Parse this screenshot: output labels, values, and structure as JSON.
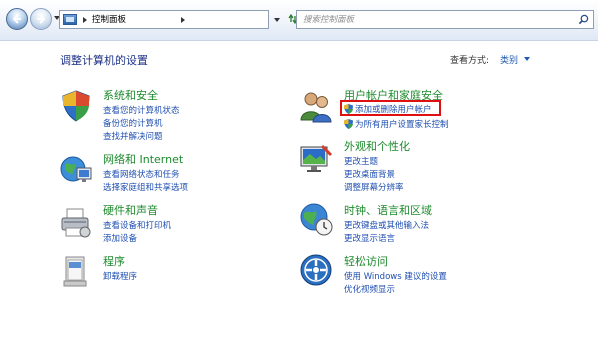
{
  "navbar": {
    "breadcrumb": "控制面板",
    "search_placeholder": "搜索控制面板"
  },
  "main": {
    "page_title": "调整计算机的设置",
    "view_by_label": "查看方式:",
    "view_by_value": "类别"
  },
  "categories": {
    "system": {
      "title": "系统和安全",
      "links": [
        "查看您的计算机状态",
        "备份您的计算机",
        "查找并解决问题"
      ]
    },
    "network": {
      "title": "网络和 Internet",
      "links": [
        "查看网络状态和任务",
        "选择家庭组和共享选项"
      ]
    },
    "hardware": {
      "title": "硬件和声音",
      "links": [
        "查看设备和打印机",
        "添加设备"
      ]
    },
    "programs": {
      "title": "程序",
      "links": [
        "卸载程序"
      ]
    },
    "user_accounts": {
      "title": "用户帐户和家庭安全",
      "links": [
        "添加或删除用户帐户",
        "为所有用户设置家长控制"
      ]
    },
    "appearance": {
      "title": "外观和个性化",
      "links": [
        "更改主题",
        "更改桌面背景",
        "调整屏幕分辨率"
      ]
    },
    "clock": {
      "title": "时钟、语言和区域",
      "links": [
        "更改键盘或其他输入法",
        "更改显示语言"
      ]
    },
    "ease": {
      "title": "轻松访问",
      "links": [
        "使用 Windows 建议的设置",
        "优化视频显示"
      ]
    }
  },
  "colors": {
    "category_title": "#1d8a2c",
    "link": "#1f4fb0",
    "highlight": "#e01010"
  }
}
